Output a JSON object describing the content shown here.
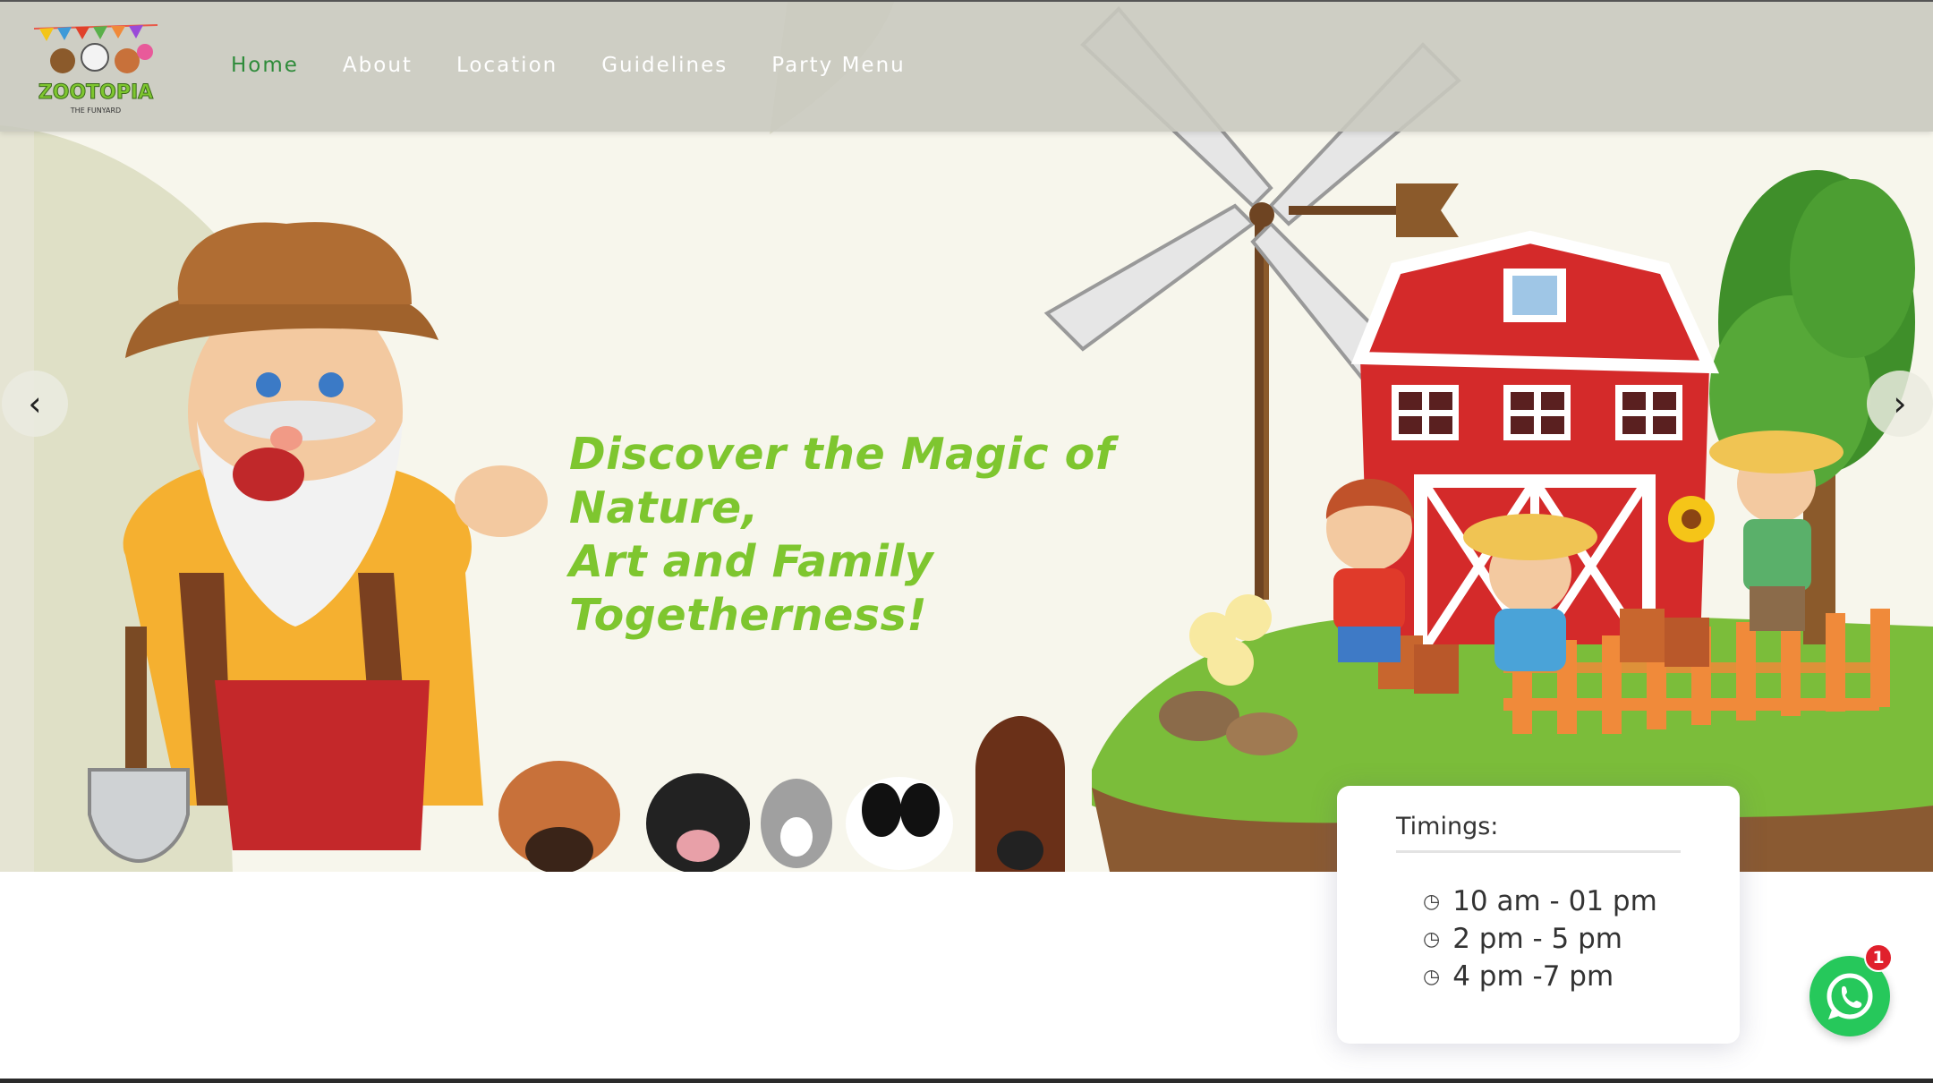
{
  "nav": {
    "logo_text": "ZOOTOPIA",
    "logo_subtext": "THE FUNYARD",
    "links": [
      {
        "label": "Home",
        "active": true
      },
      {
        "label": "About"
      },
      {
        "label": "Location"
      },
      {
        "label": "Guidelines"
      },
      {
        "label": "Party Menu"
      }
    ]
  },
  "hero": {
    "heading_line1": "Discover the Magic of Nature,",
    "heading_line2": "Art and Family Togetherness!",
    "prev_icon": "chevron-left-icon",
    "next_icon": "chevron-right-icon",
    "prev_glyph": "‹",
    "next_glyph": "›"
  },
  "timings": {
    "title": "Timings:",
    "slots": [
      "10 am - 01 pm",
      "2 pm - 5 pm",
      "4 pm -7 pm"
    ],
    "icon": "clock-icon"
  },
  "whatsapp": {
    "icon": "whatsapp-icon",
    "badge_count": "1"
  },
  "colors": {
    "heading": "#7ec62f",
    "nav_active": "#2e8b3a",
    "nav_bg": "#c8c8be",
    "barn_red": "#d42a2a",
    "whatsapp_green": "#26c85b",
    "badge_red": "#e0202c"
  }
}
